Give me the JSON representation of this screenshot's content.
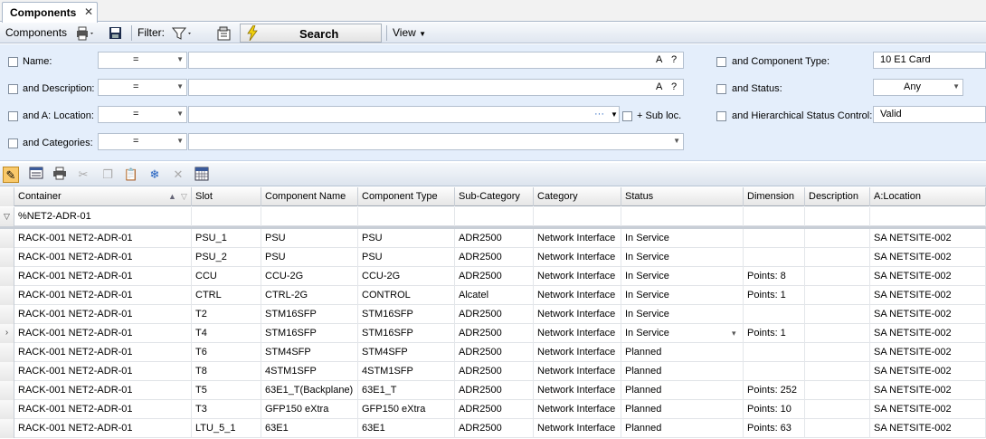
{
  "tab": {
    "title": "Components",
    "close": "✕"
  },
  "toolbar": {
    "components_label": "Components",
    "filter_label": "Filter:",
    "search_label": "Search",
    "view_label": "View"
  },
  "filter": {
    "name_label": "Name:",
    "name_op": "=",
    "description_label": "and Description:",
    "description_op": "=",
    "location_label": "and A: Location:",
    "location_op": "=",
    "sub_loc_label": "+ Sub loc.",
    "categories_label": "and Categories:",
    "categories_op": "=",
    "component_type_label": "and Component Type:",
    "component_type_value": "10 E1 Card",
    "status_label": "and Status:",
    "status_value": "Any",
    "hier_status_label": "and Hierarchical Status Control:",
    "hier_status_value": "Valid",
    "text_icon": "A",
    "help_icon": "?",
    "dots_icon": "···"
  },
  "grid": {
    "columns": [
      "Container",
      "Slot",
      "Component Name",
      "Component Type",
      "Sub-Category",
      "Category",
      "Status",
      "Dimension",
      "Description",
      "A:Location"
    ],
    "filter_value": "%NET2-ADR-01",
    "rows": [
      [
        "RACK-001 NET2-ADR-01",
        "PSU_1",
        "PSU",
        "PSU",
        "ADR2500",
        "Network Interface",
        "In Service",
        "",
        "",
        "SA NETSITE-002"
      ],
      [
        "RACK-001 NET2-ADR-01",
        "PSU_2",
        "PSU",
        "PSU",
        "ADR2500",
        "Network Interface",
        "In Service",
        "",
        "",
        "SA NETSITE-002"
      ],
      [
        "RACK-001 NET2-ADR-01",
        "CCU",
        "CCU-2G",
        "CCU-2G",
        "ADR2500",
        "Network Interface",
        "In Service",
        "Points: 8",
        "",
        "SA NETSITE-002"
      ],
      [
        "RACK-001 NET2-ADR-01",
        "CTRL",
        "CTRL-2G",
        "CONTROL",
        "Alcatel",
        "Network Interface",
        "In Service",
        "Points: 1",
        "",
        "SA NETSITE-002"
      ],
      [
        "RACK-001 NET2-ADR-01",
        "T2",
        "STM16SFP",
        "STM16SFP",
        "ADR2500",
        "Network Interface",
        "In Service",
        "",
        "",
        "SA NETSITE-002"
      ],
      [
        "RACK-001 NET2-ADR-01",
        "T4",
        "STM16SFP",
        "STM16SFP",
        "ADR2500",
        "Network Interface",
        "In Service",
        "Points: 1",
        "",
        "SA NETSITE-002"
      ],
      [
        "RACK-001 NET2-ADR-01",
        "T6",
        "STM4SFP",
        "STM4SFP",
        "ADR2500",
        "Network Interface",
        "Planned",
        "",
        "",
        "SA NETSITE-002"
      ],
      [
        "RACK-001 NET2-ADR-01",
        "T8",
        "4STM1SFP",
        "4STM1SFP",
        "ADR2500",
        "Network Interface",
        "Planned",
        "",
        "",
        "SA NETSITE-002"
      ],
      [
        "RACK-001 NET2-ADR-01",
        "T5",
        "63E1_T(Backplane)",
        "63E1_T",
        "ADR2500",
        "Network Interface",
        "Planned",
        "Points: 252",
        "",
        "SA NETSITE-002"
      ],
      [
        "RACK-001 NET2-ADR-01",
        "T3",
        "GFP150 eXtra",
        "GFP150 eXtra",
        "ADR2500",
        "Network Interface",
        "Planned",
        "Points: 10",
        "",
        "SA NETSITE-002"
      ],
      [
        "RACK-001 NET2-ADR-01",
        "LTU_5_1",
        "63E1",
        "63E1",
        "ADR2500",
        "Network Interface",
        "Planned",
        "Points: 63",
        "",
        "SA NETSITE-002"
      ]
    ]
  },
  "colors": {
    "filter_bg": "#e4eefb",
    "accent": "#1f5fbf"
  }
}
